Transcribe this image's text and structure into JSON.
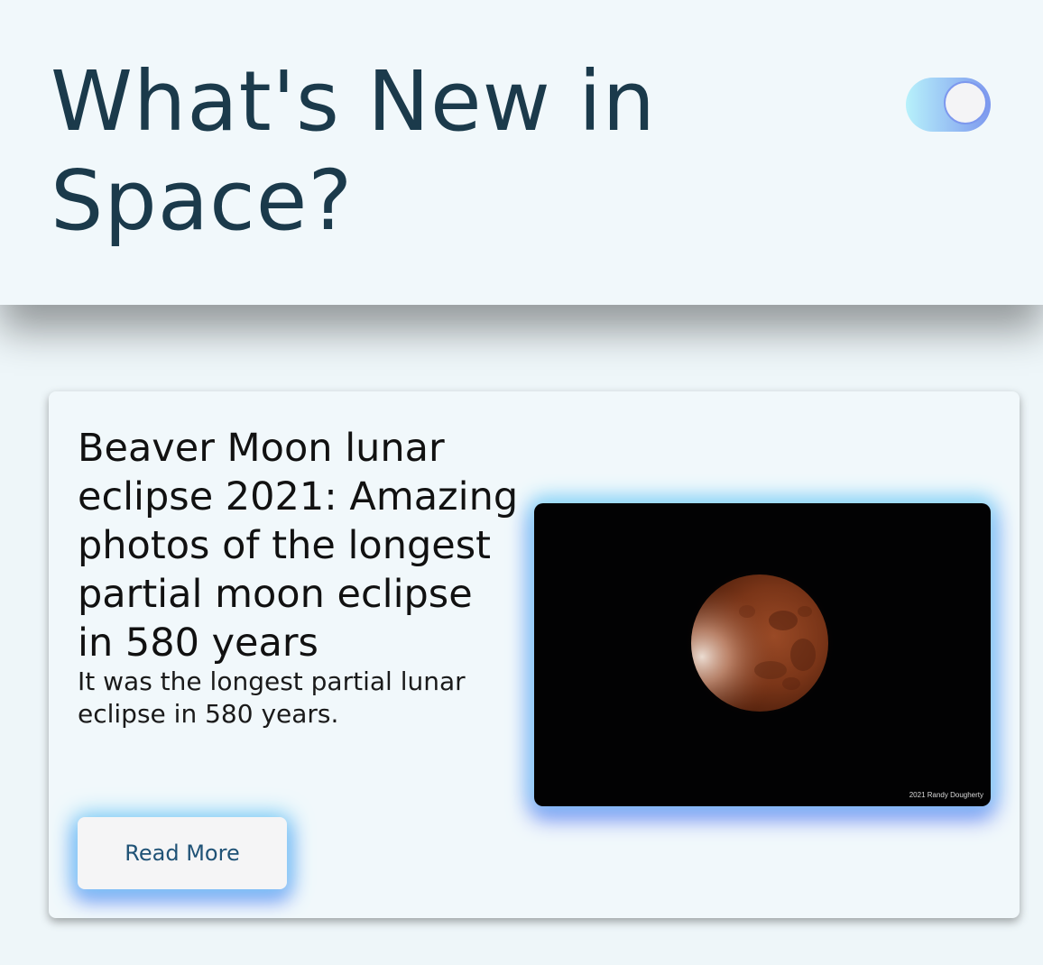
{
  "header": {
    "title": "What's New in Space?",
    "toggle_state": "on"
  },
  "article": {
    "title": "Beaver Moon lunar eclipse 2021: Amazing photos of the longest partial moon eclipse in 580 years",
    "description": "It was the longest partial lunar eclipse in 580 years.",
    "read_more_label": "Read More",
    "image_credit": "2021 Randy Dougherty"
  },
  "colors": {
    "title": "#1b3a4b",
    "toggle_start": "#b7f1fb",
    "toggle_end": "#7d98ee",
    "button_text": "#1f5276"
  }
}
